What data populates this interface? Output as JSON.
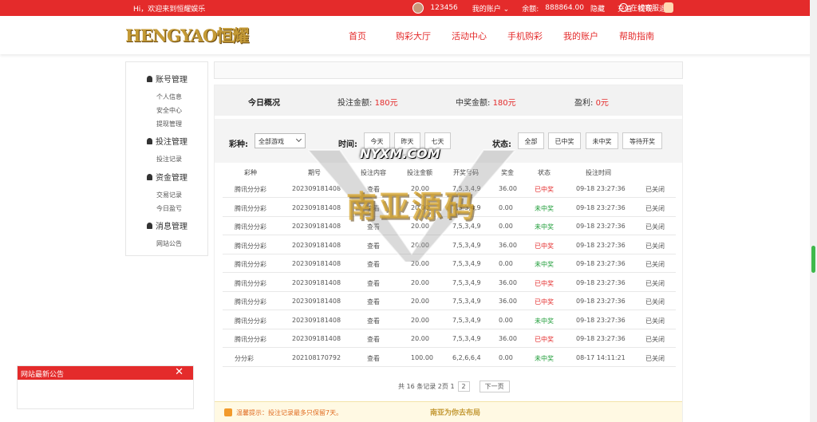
{
  "topbar": {
    "welcome": "Hi，欢迎来到恒耀娱乐",
    "user_id": "123456",
    "my_account": "我的账户",
    "balance_label": "余额:",
    "balance": "888864.00",
    "hide": "隐藏",
    "recharge": "充值",
    "withdraw": "提现",
    "logout": "退出",
    "service": "在线客服"
  },
  "logo": "HENGYAO恒耀",
  "nav": [
    "首页",
    "购彩大厅",
    "活动中心",
    "手机购彩",
    "我的账户",
    "帮助指南"
  ],
  "sidebar": {
    "groups": [
      {
        "title": "账号管理",
        "items": [
          "个人信息",
          "安全中心",
          "提现管理"
        ]
      },
      {
        "title": "投注管理",
        "items": [
          "投注记录"
        ]
      },
      {
        "title": "资金管理",
        "items": [
          "交易记录",
          "今日盈亏"
        ]
      },
      {
        "title": "消息管理",
        "items": [
          "网站公告"
        ]
      }
    ]
  },
  "overview": {
    "title": "今日概况",
    "bet_label": "投注金额:",
    "bet_value": "180元",
    "win_label": "中奖金额:",
    "win_value": "180元",
    "profit_label": "盈利:",
    "profit_value": "0元"
  },
  "filter": {
    "game_label": "彩种:",
    "game_select": "全部游戏",
    "time_label": "时间:",
    "time_buttons": [
      "今天",
      "昨天",
      "七天"
    ],
    "status_label": "状态:",
    "status_buttons": [
      "全部",
      "已中奖",
      "未中奖",
      "等待开奖"
    ]
  },
  "table": {
    "headers": [
      "彩种",
      "期号",
      "投注内容",
      "投注金额",
      "开奖号码",
      "奖金",
      "状态",
      "投注时间"
    ],
    "rows": [
      {
        "game": "腾讯分分彩",
        "issue": "202309181408",
        "content": "查看",
        "amount": "20.00",
        "numbers": "7,5,3,4,9",
        "prize": "36.00",
        "status": "已中奖",
        "time": "09-18 23:27:36",
        "action": "已关闭",
        "win": true
      },
      {
        "game": "腾讯分分彩",
        "issue": "202309181408",
        "content": "查看",
        "amount": "20.00",
        "numbers": "7,5,3,4,9",
        "prize": "0.00",
        "status": "未中奖",
        "time": "09-18 23:27:36",
        "action": "已关闭",
        "win": false
      },
      {
        "game": "腾讯分分彩",
        "issue": "202309181408",
        "content": "查看",
        "amount": "20.00",
        "numbers": "7,5,3,4,9",
        "prize": "0.00",
        "status": "未中奖",
        "time": "09-18 23:27:36",
        "action": "已关闭",
        "win": false
      },
      {
        "game": "腾讯分分彩",
        "issue": "202309181408",
        "content": "查看",
        "amount": "20.00",
        "numbers": "7,5,3,4,9",
        "prize": "36.00",
        "status": "已中奖",
        "time": "09-18 23:27:36",
        "action": "已关闭",
        "win": true
      },
      {
        "game": "腾讯分分彩",
        "issue": "202309181408",
        "content": "查看",
        "amount": "20.00",
        "numbers": "7,5,3,4,9",
        "prize": "0.00",
        "status": "未中奖",
        "time": "09-18 23:27:36",
        "action": "已关闭",
        "win": false
      },
      {
        "game": "腾讯分分彩",
        "issue": "202309181408",
        "content": "查看",
        "amount": "20.00",
        "numbers": "7,5,3,4,9",
        "prize": "36.00",
        "status": "已中奖",
        "time": "09-18 23:27:36",
        "action": "已关闭",
        "win": true
      },
      {
        "game": "腾讯分分彩",
        "issue": "202309181408",
        "content": "查看",
        "amount": "20.00",
        "numbers": "7,5,3,4,9",
        "prize": "36.00",
        "status": "已中奖",
        "time": "09-18 23:27:36",
        "action": "已关闭",
        "win": true
      },
      {
        "game": "腾讯分分彩",
        "issue": "202309181408",
        "content": "查看",
        "amount": "20.00",
        "numbers": "7,5,3,4,9",
        "prize": "0.00",
        "status": "未中奖",
        "time": "09-18 23:27:36",
        "action": "已关闭",
        "win": false
      },
      {
        "game": "腾讯分分彩",
        "issue": "202309181408",
        "content": "查看",
        "amount": "20.00",
        "numbers": "7,5,3,4,9",
        "prize": "36.00",
        "status": "已中奖",
        "time": "09-18 23:27:36",
        "action": "已关闭",
        "win": true
      },
      {
        "game": "分分彩",
        "issue": "202108170792",
        "content": "查看",
        "amount": "100.00",
        "numbers": "6,2,6,6,4",
        "prize": "0.00",
        "status": "未中奖",
        "time": "08-17 14:11:21",
        "action": "已关闭",
        "win": false
      }
    ]
  },
  "pager": {
    "summary": "共 16 条记录 2页 1",
    "current": "2",
    "next": "下一页"
  },
  "tip": {
    "text": "温馨提示：投注记录最多只保留7天。",
    "watermark_small": "南亚为你去布局"
  },
  "notice": {
    "title": "网站最新公告",
    "close": "✕"
  },
  "watermark": {
    "tag": "NYXM.COM",
    "text": "南亚源码"
  },
  "colors": {
    "brand_red": "#e42b2b",
    "win_red": "#e42b2b",
    "lose_green": "#1d9c37",
    "gold": "#c49a36"
  }
}
